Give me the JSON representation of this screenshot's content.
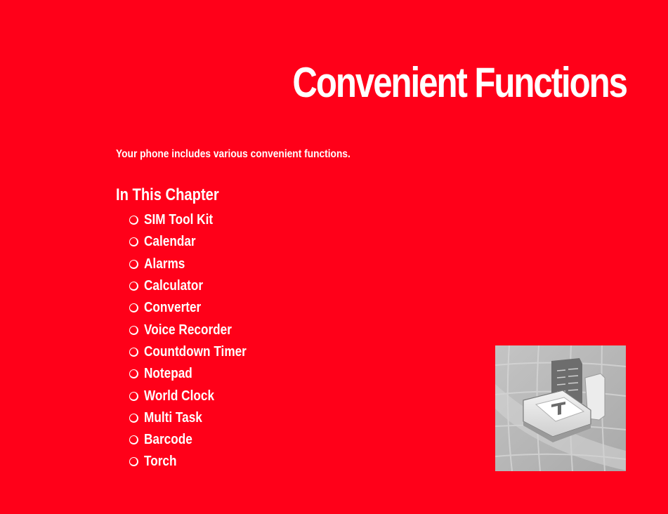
{
  "page": {
    "title": "Convenient Functions",
    "intro": "Your phone includes various convenient functions.",
    "background_color": "#ff0019"
  },
  "chapter": {
    "heading": "In This Chapter",
    "bullet_icon": "circle-bullet-icon",
    "items": [
      {
        "label": "SIM Tool Kit"
      },
      {
        "label": "Calendar"
      },
      {
        "label": "Alarms"
      },
      {
        "label": "Calculator"
      },
      {
        "label": "Converter"
      },
      {
        "label": "Voice Recorder"
      },
      {
        "label": "Countdown Timer"
      },
      {
        "label": "Notepad"
      },
      {
        "label": "World Clock"
      },
      {
        "label": "Multi Task"
      },
      {
        "label": "Barcode"
      },
      {
        "label": "Torch"
      }
    ]
  },
  "illustration": {
    "subject": "calculator-device-icon"
  }
}
